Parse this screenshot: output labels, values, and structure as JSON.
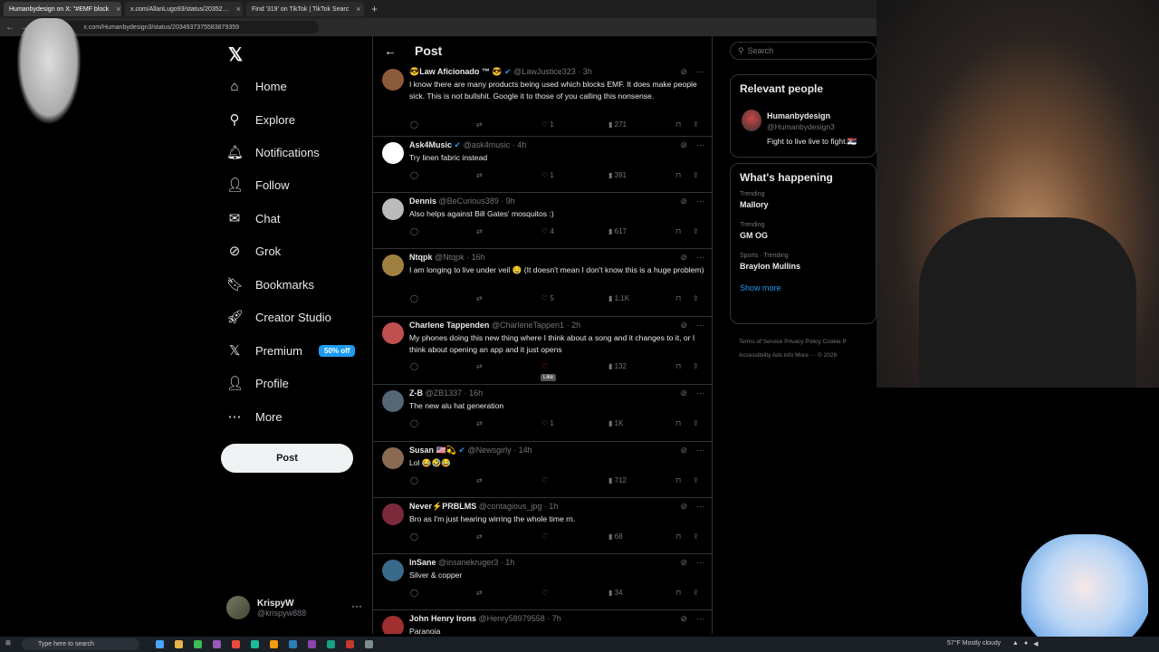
{
  "browser": {
    "tabs": [
      {
        "label": "Humanbydesign on X: \"#EMF block",
        "active": true
      },
      {
        "label": "x.com/AllanLugo93/status/20352…",
        "active": false
      },
      {
        "label": "Find '319' on TikTok | TikTok Searc",
        "active": false
      }
    ],
    "url": "x.com/Humanbydesign3/status/2034937375583879359"
  },
  "nav": {
    "items": [
      {
        "label": "Home",
        "icon": "home-icon",
        "glyph": "⌂"
      },
      {
        "label": "Explore",
        "icon": "search-icon",
        "glyph": "⚲"
      },
      {
        "label": "Notifications",
        "icon": "bell-icon",
        "glyph": "🔔︎"
      },
      {
        "label": "Follow",
        "icon": "person-plus-icon",
        "glyph": "👤︎"
      },
      {
        "label": "Chat",
        "icon": "envelope-icon",
        "glyph": "✉"
      },
      {
        "label": "Grok",
        "icon": "grok-icon",
        "glyph": "⊘"
      },
      {
        "label": "Bookmarks",
        "icon": "bookmark-icon",
        "glyph": "🔖︎"
      },
      {
        "label": "Creator Studio",
        "icon": "rocket-icon",
        "glyph": "🚀︎"
      },
      {
        "label": "Premium",
        "icon": "x-logo-icon",
        "glyph": "𝕏"
      },
      {
        "label": "Profile",
        "icon": "person-icon",
        "glyph": "👤︎"
      },
      {
        "label": "More",
        "icon": "more-circle-icon",
        "glyph": "⋯"
      }
    ],
    "premium_badge": "50% off",
    "post_label": "Post",
    "logo_glyph": "𝕏"
  },
  "account": {
    "name": "KrispyW",
    "handle": "@krispyw888",
    "more": "···"
  },
  "main": {
    "title": "Post",
    "back": "←",
    "tweets": [
      {
        "name": "😎Law Aficionado ™ 😎",
        "meta": "@LawJustice323 · 3h",
        "verified": true,
        "text": "I know there are many products being used which blocks EMF. It does make people sick. This is not bullshit. Google it to those of you calling this nonsense.",
        "likes": "1",
        "views": "271",
        "avatar_color": "#8a5a3a"
      },
      {
        "name": "Ask4Music",
        "meta": "@ask4music · 4h",
        "verified": true,
        "text": "Try linen fabric instead",
        "likes": "1",
        "views": "391",
        "avatar_color": "#ffffff"
      },
      {
        "name": "Dennis",
        "meta": "@BeCurious389 · 9h",
        "verified": false,
        "text": "Also helps against Bill Gates' mosquitos :)",
        "likes": "4",
        "views": "617",
        "avatar_color": "#bbbbbb"
      },
      {
        "name": "Ntqpk",
        "meta": "@Ntqpk · 16h",
        "verified": false,
        "text": "I am longing to live under veil 🤤 (It doesn't mean I don't know this is a huge problem)",
        "likes": "5",
        "views": "1.1K",
        "avatar_color": "#a08040"
      },
      {
        "name": "Charlene Tappenden",
        "meta": "@CharleneTappen1 · 2h",
        "verified": false,
        "text": "My phones doing this new thing where I think about a song and it changes to it, or I think about opening an app and it just opens",
        "likes": "",
        "views": "132",
        "avatar_color": "#c05050",
        "liked_hover": true,
        "tooltip": "Like"
      },
      {
        "name": "Z-B",
        "meta": "@ZB1337 · 16h",
        "verified": false,
        "text": "The new alu hat generation",
        "likes": "1",
        "views": "1K",
        "avatar_color": "#556677"
      },
      {
        "name": "Susan 🇺🇸💫",
        "meta": "@Newsgirly · 14h",
        "verified": true,
        "text": "Lol 😂🤣😂",
        "likes": "",
        "views": "712",
        "avatar_color": "#8a6a50"
      },
      {
        "name": "Never⚡PRBLMS",
        "meta": "@contagious_jpg · 1h",
        "verified": false,
        "text": "Bro as I'm just hearing wirring the whole time rn.",
        "likes": "",
        "views": "68",
        "avatar_color": "#7a2a3a"
      },
      {
        "name": "InSane",
        "meta": "@insanekruger3 · 1h",
        "verified": false,
        "text": "Silver & copper",
        "likes": "",
        "views": "34",
        "avatar_color": "#3a6a8a"
      },
      {
        "name": "John Henry Irons",
        "meta": "@Henry58979558 · 7h",
        "verified": false,
        "text": "Paranoia",
        "likes": "",
        "views": "",
        "avatar_color": "#a03030"
      }
    ]
  },
  "right": {
    "search_placeholder": "Search",
    "relevant_title": "Relevant people",
    "relevant_person": {
      "name": "Humanbydesign",
      "handle": "@Humanbydesign3",
      "bio": "Fight to live live to fight.🇷🇸"
    },
    "happening_title": "What's happening",
    "trends": [
      {
        "context": "Trending",
        "name": "Mallory"
      },
      {
        "context": "Trending",
        "name": "GM OG"
      },
      {
        "context": "Sports · Trending",
        "name": "Braylon Mullins"
      }
    ],
    "show_more": "Show more",
    "footer_line1": "Terms of Service   Privacy Policy   Cookie P",
    "footer_line2": "Accessibility   Ads info   More ···   © 2026"
  },
  "taskbar": {
    "search_placeholder": "Type here to search",
    "weather": "57°F  Mostly cloudy"
  },
  "colors": {
    "accent": "#1d9bf0",
    "like": "#f91880",
    "border": "#2f3336",
    "muted": "#71767b"
  }
}
